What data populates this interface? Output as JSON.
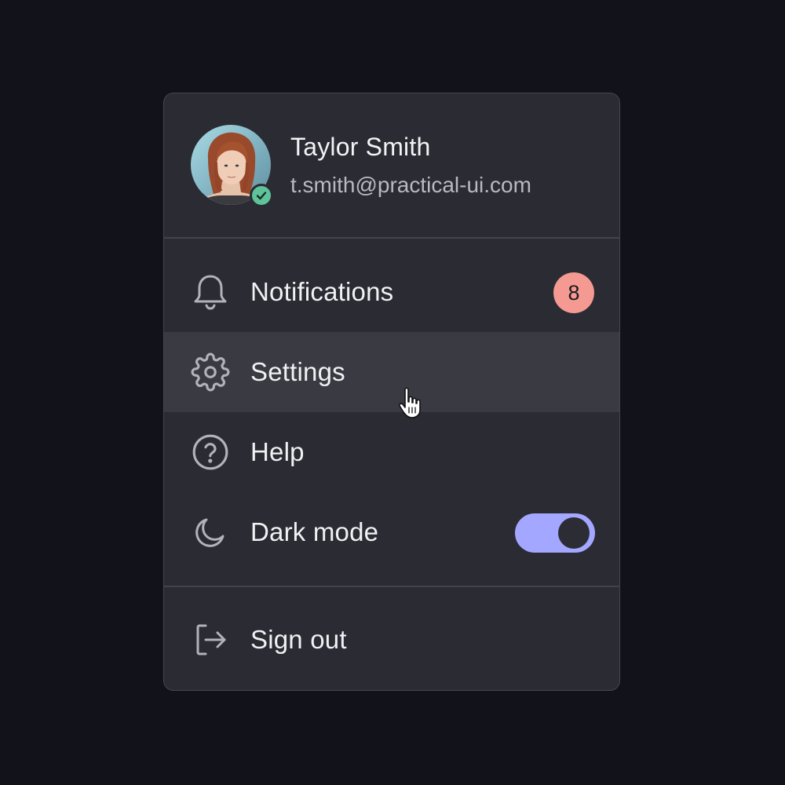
{
  "profile": {
    "name": "Taylor Smith",
    "email": "t.smith@practical-ui.com",
    "status": "online",
    "status_color": "#5fc39a"
  },
  "menu": {
    "notifications": {
      "label": "Notifications",
      "icon": "bell-icon",
      "badge_count": "8",
      "badge_color": "#f59a93"
    },
    "settings": {
      "label": "Settings",
      "icon": "gear-icon",
      "state": "hovered"
    },
    "help": {
      "label": "Help",
      "icon": "help-circle-icon"
    },
    "dark_mode": {
      "label": "Dark mode",
      "icon": "moon-icon",
      "toggle_on": true,
      "toggle_color": "#a3a7ff"
    },
    "sign_out": {
      "label": "Sign out",
      "icon": "sign-out-icon"
    }
  },
  "theme": {
    "background": "#12131a",
    "panel": "#2a2b33",
    "hover": "#393a42"
  },
  "cursor": "pointer-hand-icon"
}
